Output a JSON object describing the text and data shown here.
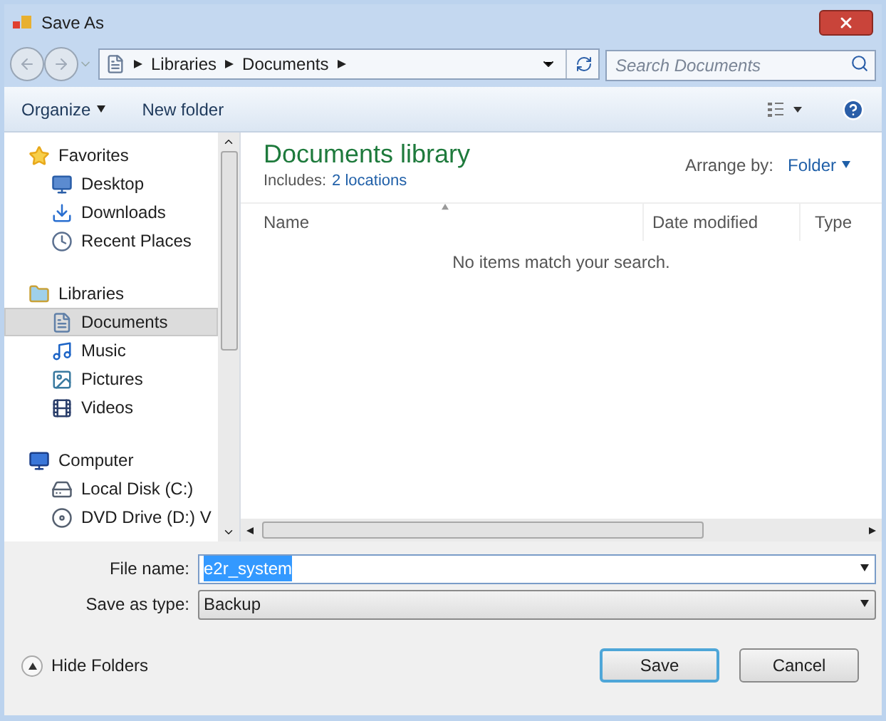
{
  "window": {
    "title": "Save As"
  },
  "address": {
    "path": [
      "Libraries",
      "Documents"
    ]
  },
  "search": {
    "placeholder": "Search Documents"
  },
  "toolbar": {
    "organize": "Organize",
    "new_folder": "New folder"
  },
  "nav": [
    {
      "label": "Favorites",
      "selected": false,
      "children": [
        {
          "label": "Desktop",
          "selected": false
        },
        {
          "label": "Downloads",
          "selected": false
        },
        {
          "label": "Recent Places",
          "selected": false
        }
      ]
    },
    {
      "label": "Libraries",
      "selected": false,
      "children": [
        {
          "label": "Documents",
          "selected": true
        },
        {
          "label": "Music",
          "selected": false
        },
        {
          "label": "Pictures",
          "selected": false
        },
        {
          "label": "Videos",
          "selected": false
        }
      ]
    },
    {
      "label": "Computer",
      "selected": false,
      "children": [
        {
          "label": "Local Disk (C:)",
          "selected": false
        },
        {
          "label": "DVD Drive (D:) V",
          "selected": false
        }
      ]
    }
  ],
  "content": {
    "title": "Documents library",
    "includes_label": "Includes:",
    "includes_link": "2 locations",
    "arrange_label": "Arrange by:",
    "arrange_value": "Folder",
    "columns": [
      {
        "label": "Name",
        "sorted": true
      },
      {
        "label": "Date modified",
        "sorted": false
      },
      {
        "label": "Type",
        "sorted": false
      }
    ],
    "empty_message": "No items match your search."
  },
  "form": {
    "file_name_label": "File name:",
    "file_name_value": "e2r_system",
    "file_name_selected": true,
    "save_type_label": "Save as type:",
    "save_type_value": "Backup"
  },
  "hide_folders": "Hide Folders",
  "buttons": [
    {
      "label": "Save",
      "default": true
    },
    {
      "label": "Cancel",
      "default": false
    }
  ]
}
